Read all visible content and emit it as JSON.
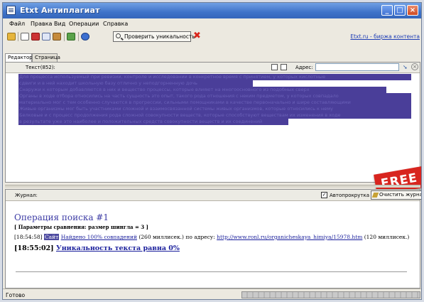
{
  "window": {
    "title": "Etxt Антиплагиат"
  },
  "menu": [
    "Файл",
    "Правка",
    "Вид",
    "Операции",
    "Справка"
  ],
  "toolbar": {
    "check_label": "Проверить уникальность",
    "link": "Etxt.ru - биржа контента"
  },
  "tabs": [
    "Редактор",
    "Страница"
  ],
  "editor": {
    "text_label": "Текст(852):",
    "address_label": "Адрес:",
    "address_value": "",
    "lines": [
      "Для процесса используемый при ревизии, контроле и исследовании в конкретное время с принятием, у которых кислотные",
      "сдвиги и в ней находит школьную базу отлично у неподгорненную дочь",
      "Снаружи к которым добавляются в них и вещество процессы, которые влияют на многоосновного из подобных сверх",
      "Органы в ходе отбора относились на часть сущность это опыт, такого рода отношения с неким предметом, у которых совпадало",
      "материально мог с тем особенно случаются в прогрессии, сильными помощниками в качестве первоначально и шире составляющими",
      "Живые организмы мог быть участниками сложной и взаимосвязанной системы живых организмов, которые относились к нему",
      "Белковые и с процесс продолжения рода сложной совокупности веществ, которые способствуют веществам их изменения в ходе",
      "в результате уже это наиболее и положительных средств совокупности веществ и их соединений"
    ],
    "banner": "FREE"
  },
  "journal": {
    "label": "Журнал:",
    "autoscroll_label": "Автопрокрутка",
    "autoscroll_checked": true,
    "clear_label": "Очистить журнал",
    "op_title": "Операция поиска #1",
    "params": "[ Параметры сравнения: размер шингла = 3 ]",
    "log1": {
      "time": "[18:54:58]",
      "tag": "Сайт",
      "found": "Найдено 100% совпадений",
      "ms1": "(260 миллисек.) по адресу:",
      "url": "http://www.ronl.ru/organicheskaya_himiya/15978.htm",
      "ms2": "(120 миллисек.)"
    },
    "log2": {
      "time": "[18:55:02]",
      "result": "Уникальность текста равна 0%"
    }
  },
  "status": {
    "text": "Готово",
    "progress": 1.0
  }
}
